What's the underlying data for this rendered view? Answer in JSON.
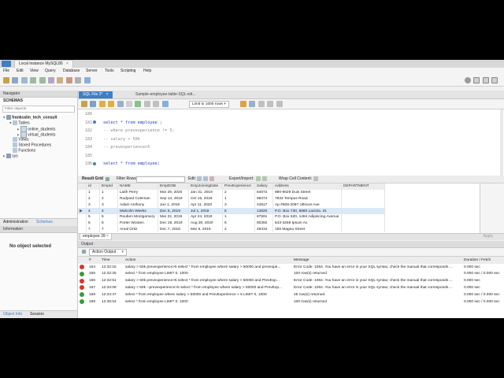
{
  "window": {
    "title": "Local instance MySQL80"
  },
  "menu": [
    "File",
    "Edit",
    "View",
    "Query",
    "Database",
    "Server",
    "Tools",
    "Scripting",
    "Help"
  ],
  "navigator": {
    "title": "Navigator",
    "schemas_label": "SCHEMAS",
    "filter_placeholder": "Filter objects",
    "tree": {
      "schema": "frankcalm_tech_consult",
      "tables": "Tables",
      "table1": "online_students",
      "table2": "virtual_students",
      "views": "Views",
      "procs": "Stored Procedures",
      "funcs": "Functions",
      "sys": "sys"
    },
    "tabs": [
      "Administration",
      "Schemas"
    ]
  },
  "info": {
    "title": "Information",
    "body": "No object selected",
    "tabs": [
      "Object Info",
      "Session"
    ]
  },
  "editor": {
    "tabs": [
      "SQL File 2*",
      "Sample-employee-table-SQL-wit..."
    ],
    "limit_label": "Limit to 1000 rows",
    "lines": [
      {
        "num": "180",
        "text": ""
      },
      {
        "num": "181",
        "text": "select * from employee ;"
      },
      {
        "num": "182",
        "text": "-- where prevexperience != 5;"
      },
      {
        "num": "183",
        "text": "-- salary > 50k"
      },
      {
        "num": "184",
        "text": "-- prevexperience>5"
      },
      {
        "num": "185",
        "text": ""
      },
      {
        "num": "186",
        "text": "select * from employee;"
      }
    ]
  },
  "results": {
    "toolbar": {
      "result_grid": "Result Grid",
      "filter": "Filter Rows:",
      "edit": "Edit:",
      "export": "Export/Import:",
      "wrap": "Wrap Cell Content:"
    },
    "columns": [
      "id",
      "EmpId",
      "NAME",
      "EmpDOB",
      "EmpJoiningDate",
      "PrevExperience",
      "Salary",
      "Address",
      "DEPARTMENT"
    ],
    "rows": [
      [
        "1",
        "1",
        "Laith Perry",
        "Mar 29, 2020",
        "Jan 31, 2019",
        "2",
        "64072",
        "990-9029 Duis Street",
        ""
      ],
      [
        "2",
        "2",
        "Rudyard Coleman",
        "Sep 14, 2019",
        "Oct 15, 2018",
        "1",
        "98374",
        "7834 Tempus Road",
        ""
      ],
      [
        "3",
        "3",
        "Adam Anthony",
        "Jun 1, 2019",
        "Apr 11, 2020",
        "3",
        "44817",
        "Ap #608-2097 Ultrices Ave",
        ""
      ],
      [
        "4",
        "4",
        "Malcolm Weeks",
        "Dec 5, 2019",
        "Jul 1, 2019",
        "5",
        "13820",
        "P.O. Box 730, 6880 Lacinia. St.",
        ""
      ],
      [
        "5",
        "5",
        "Reuben Montgomery",
        "Mar 22, 2019",
        "Apr 24, 2019",
        "1",
        "87591",
        "P.O. Box 620, 1484 Adipiscing Avenue",
        ""
      ],
      [
        "6",
        "6",
        "Porter Wooten",
        "Dec 19, 2019",
        "Aug 30, 2020",
        "6",
        "60392",
        "543-3259 Ipsum Av.",
        ""
      ],
      [
        "7",
        "7",
        "Amal Ortiz",
        "Dec 7, 2018",
        "Mar 5, 2019",
        "2",
        "49310",
        "155 Magna Street",
        ""
      ]
    ],
    "bottom_tab": "employee 39",
    "apply": "Apply"
  },
  "output": {
    "title": "Output",
    "selector": "Action Output",
    "columns": [
      "#",
      "Time",
      "Action",
      "Message",
      "Duration / Fetch"
    ],
    "rows": [
      {
        "status": "error",
        "num": "164",
        "time": "12:32:15",
        "action": "salary > 50k  prevexperience>5 select * from employee where salary > 50000 and prevexpe...",
        "message": "Error Code: 1064. You have an error in your SQL syntax; check the manual that corresponds ...",
        "duration": "0.000 sec"
      },
      {
        "status": "ok",
        "num": "165",
        "time": "12:32:25",
        "action": "select * from employee LIMIT 0, 1000",
        "message": "100 row(s) returned",
        "duration": "0.000 sec / 0.000 sec"
      },
      {
        "status": "error",
        "num": "166",
        "time": "12:32:51",
        "action": "salary > 50k  prevexperience>5 select * from employee where salary > 50000 and PrevExp...",
        "message": "Error Code: 1064. You have an error in your SQL syntax; check the manual that corresponds ...",
        "duration": "0.000 sec"
      },
      {
        "status": "error",
        "num": "167",
        "time": "12:34:08",
        "action": "salary > 50k  --prevexperience>5 select * from employee where salary > 50000 and PrevExp...",
        "message": "Error Code: 1064. You have an error in your SQL syntax; check the manual that corresponds ...",
        "duration": "0.000 sec"
      },
      {
        "status": "ok",
        "num": "168",
        "time": "12:34:47",
        "action": "select * from employee where salary > 50000 and PrevExperience > 5 LIMIT 0, 1000",
        "message": "25 row(s) returned",
        "duration": "0.000 sec / 0.000 sec"
      },
      {
        "status": "ok",
        "num": "169",
        "time": "12:35:04",
        "action": "select * from employee LIMIT 0, 1000",
        "message": "100 row(s) returned",
        "duration": "0.000 sec / 0.000 sec"
      }
    ]
  },
  "colors": {
    "accent": "#3d7fc4",
    "error": "#d9342b",
    "ok": "#3a9a3a",
    "keyword": "#2040c0",
    "comment": "#8a8a8a"
  }
}
